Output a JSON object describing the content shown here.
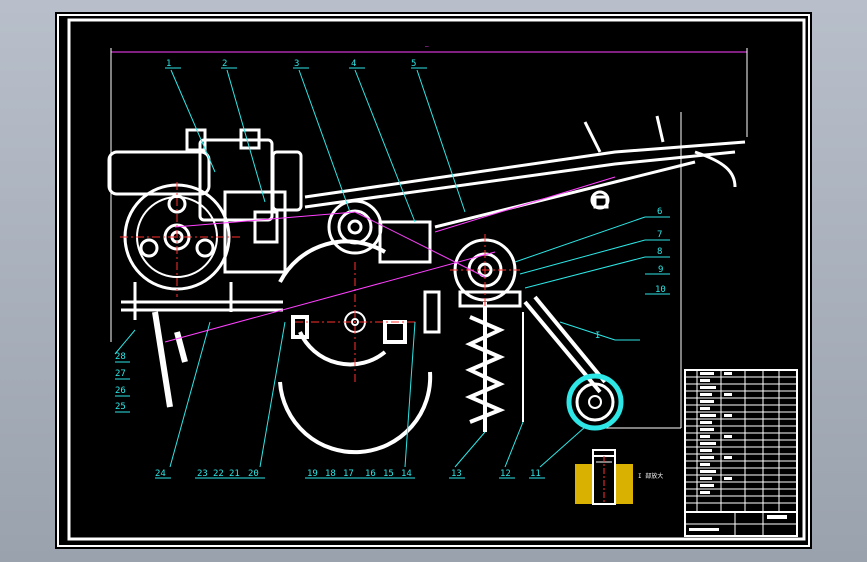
{
  "drawing": {
    "part_labels_top": [
      "1",
      "2",
      "3",
      "4",
      "5"
    ],
    "part_labels_right": [
      "6",
      "7",
      "8",
      "9",
      "10"
    ],
    "detail_label": "I",
    "part_labels_left": [
      "28",
      "27",
      "26",
      "25"
    ],
    "part_labels_bottom": [
      "24",
      "23",
      "22",
      "21",
      "20",
      "19",
      "18",
      "17",
      "16",
      "15",
      "14",
      "13",
      "12",
      "11"
    ],
    "detail_view_caption": "I 部放大",
    "dimension_text": "—"
  },
  "colors": {
    "background": "#000000",
    "frame": "#ffffff",
    "part_lines": "#ffffff",
    "leaders": "#2ee6e6",
    "centerlines": "#ff3030",
    "motion_path": "#ff40ff",
    "detail_hatch": "#ffd000"
  }
}
